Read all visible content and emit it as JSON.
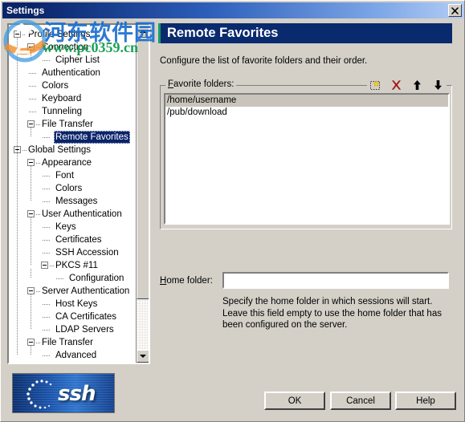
{
  "window": {
    "title": "Settings",
    "close_label": "✕"
  },
  "watermark": {
    "chinese_text": "河东软件园",
    "url_text": "www.pc0359.cn"
  },
  "tree": {
    "nodes": [
      {
        "label": "Profile Settings",
        "depth": 0,
        "expander": true,
        "selected": false
      },
      {
        "label": "Connection",
        "depth": 1,
        "expander": true,
        "selected": false
      },
      {
        "label": "Cipher List",
        "depth": 2,
        "expander": false,
        "selected": false
      },
      {
        "label": "Authentication",
        "depth": 1,
        "expander": false,
        "selected": false
      },
      {
        "label": "Colors",
        "depth": 1,
        "expander": false,
        "selected": false
      },
      {
        "label": "Keyboard",
        "depth": 1,
        "expander": false,
        "selected": false
      },
      {
        "label": "Tunneling",
        "depth": 1,
        "expander": false,
        "selected": false
      },
      {
        "label": "File Transfer",
        "depth": 1,
        "expander": true,
        "selected": false
      },
      {
        "label": "Remote Favorites",
        "depth": 2,
        "expander": false,
        "selected": true
      },
      {
        "label": "Global Settings",
        "depth": 0,
        "expander": true,
        "selected": false
      },
      {
        "label": "Appearance",
        "depth": 1,
        "expander": true,
        "selected": false
      },
      {
        "label": "Font",
        "depth": 2,
        "expander": false,
        "selected": false
      },
      {
        "label": "Colors",
        "depth": 2,
        "expander": false,
        "selected": false
      },
      {
        "label": "Messages",
        "depth": 2,
        "expander": false,
        "selected": false
      },
      {
        "label": "User Authentication",
        "depth": 1,
        "expander": true,
        "selected": false
      },
      {
        "label": "Keys",
        "depth": 2,
        "expander": false,
        "selected": false
      },
      {
        "label": "Certificates",
        "depth": 2,
        "expander": false,
        "selected": false
      },
      {
        "label": "SSH Accession",
        "depth": 2,
        "expander": false,
        "selected": false
      },
      {
        "label": "PKCS #11",
        "depth": 2,
        "expander": true,
        "selected": false
      },
      {
        "label": "Configuration",
        "depth": 3,
        "expander": false,
        "selected": false
      },
      {
        "label": "Server Authentication",
        "depth": 1,
        "expander": true,
        "selected": false
      },
      {
        "label": "Host Keys",
        "depth": 2,
        "expander": false,
        "selected": false
      },
      {
        "label": "CA Certificates",
        "depth": 2,
        "expander": false,
        "selected": false
      },
      {
        "label": "LDAP Servers",
        "depth": 2,
        "expander": false,
        "selected": false
      },
      {
        "label": "File Transfer",
        "depth": 1,
        "expander": true,
        "selected": false
      },
      {
        "label": "Advanced",
        "depth": 2,
        "expander": false,
        "selected": false
      }
    ]
  },
  "page": {
    "header": "Remote Favorites",
    "description": "Configure the list of favorite folders and their order.",
    "group": {
      "legend_accel": "F",
      "legend_rest": "avorite folders:",
      "toolbar": [
        {
          "name": "new-favorite-icon",
          "title": "New"
        },
        {
          "name": "delete-icon",
          "title": "Delete"
        },
        {
          "name": "move-up-icon",
          "title": "Move up"
        },
        {
          "name": "move-down-icon",
          "title": "Move down"
        }
      ],
      "items": [
        {
          "path": "/home/username",
          "selected": true
        },
        {
          "path": "/pub/download",
          "selected": false
        }
      ]
    },
    "home_folder": {
      "label_accel": "H",
      "label_rest": "ome folder:",
      "value": "",
      "placeholder": "",
      "hint": "Specify the home folder in which sessions will start. Leave this field empty to use the home folder that has been configured on the server."
    }
  },
  "branding": {
    "logo_text": "ssh"
  },
  "buttons": {
    "ok": "OK",
    "cancel": "Cancel",
    "help": "Help"
  },
  "colors": {
    "titlebar_start": "#0a246a",
    "titlebar_end": "#b3cdf5",
    "page_header_bg": "#0a2a6e",
    "page_header_accent": "#12a06a",
    "dialog_face": "#d4d0c8",
    "tree_selection": "#0a246a",
    "list_selection": "#c8c4bc",
    "delete_icon": "#a01818",
    "watermark_blue": "#1b6fd0",
    "watermark_green": "#119b4f"
  }
}
